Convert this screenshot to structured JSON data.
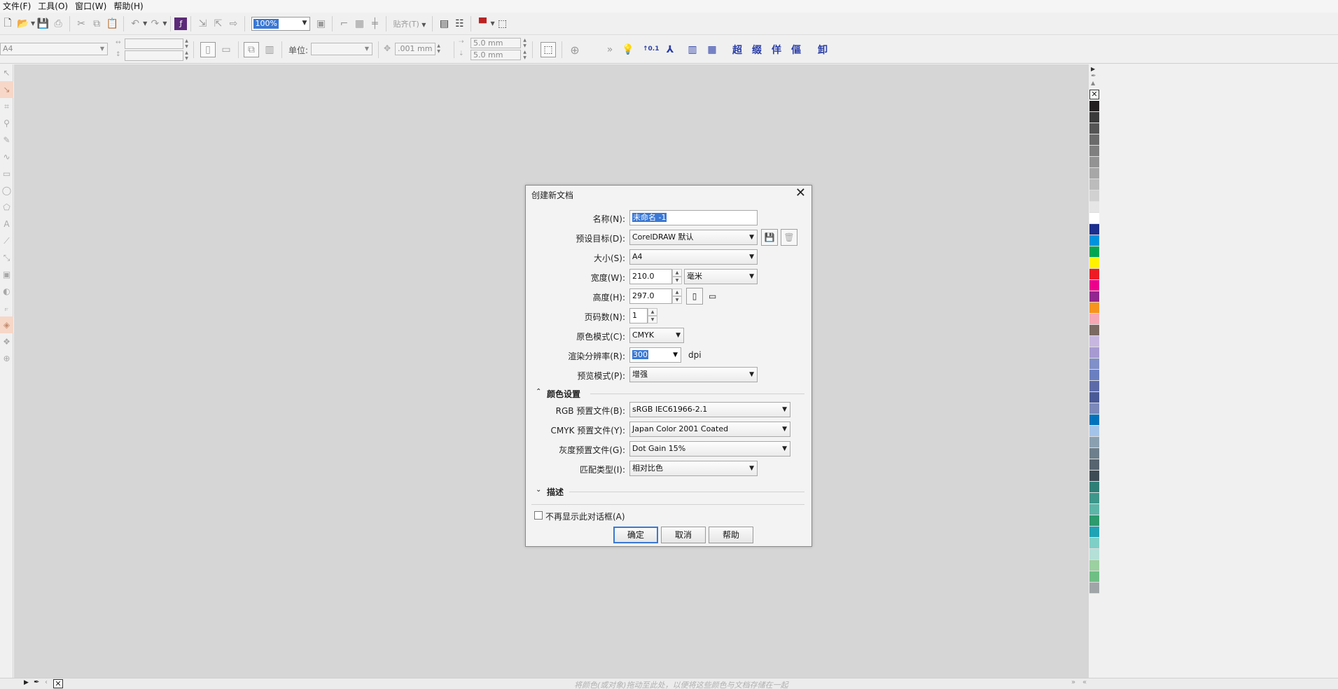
{
  "menu": [
    "文件(F)",
    "工具(O)",
    "窗口(W)",
    "帮助(H)"
  ],
  "toolbar": {
    "zoom": "100%",
    "snap_label": "贴齐(T)"
  },
  "propbar": {
    "page_size": "A4",
    "unit_label": "单位:",
    "nudge": ".001 mm",
    "dup_x": "5.0 mm",
    "dup_y": "5.0 mm",
    "tv_label": "↑0.1",
    "glyphs": [
      "超",
      "缀",
      "佯",
      "傴",
      "卸"
    ]
  },
  "status": {
    "hint": "将颜色(或对象)拖动至此处，以便将这些颜色与文档存储在一起"
  },
  "palette": [
    "#231f20",
    "#3b3b3b",
    "#555555",
    "#6b6b6b",
    "#7f7f7f",
    "#939393",
    "#a7a7a7",
    "#bcbcbc",
    "#d1d1d1",
    "#e6e6e6",
    "#ffffff",
    "#1d2f8f",
    "#0093dd",
    "#00a651",
    "#fff200",
    "#ed1c24",
    "#ec008c",
    "#92278f",
    "#f7941d",
    "#f6a7b4",
    "#7b6a63",
    "#c7b7e0",
    "#a79ad0",
    "#8090c8",
    "#6a7fc0",
    "#5c6aa8",
    "#4a5a98",
    "#7c88b8",
    "#0072bc",
    "#a3c4e8",
    "#8aa0b0",
    "#6d7f8c",
    "#56646f",
    "#3d4b55",
    "#2f7f76",
    "#3f968a",
    "#5db5a8",
    "#2e9a6d",
    "#1fa3b5",
    "#7fcfc6",
    "#b4e0d8",
    "#9bd0a0",
    "#6fbf84",
    "#a0a6a8"
  ],
  "dialog": {
    "title": "创建新文档",
    "labels": {
      "name": "名称(N):",
      "preset": "预设目标(D):",
      "size": "大小(S):",
      "width": "宽度(W):",
      "height": "高度(H):",
      "pages": "页码数(N):",
      "color_mode": "原色模式(C):",
      "resolution": "渲染分辨率(R):",
      "preview": "预览模式(P):",
      "rgb_profile": "RGB 预置文件(B):",
      "cmyk_profile": "CMYK 预置文件(Y):",
      "gray_profile": "灰度预置文件(G):",
      "match_type": "匹配类型(I):"
    },
    "values": {
      "name": "未命名 -1",
      "preset": "CorelDRAW 默认",
      "size": "A4",
      "width": "210.0 mm",
      "unit": "毫米",
      "height": "297.0 mm",
      "pages": "1",
      "color_mode": "CMYK",
      "resolution": "300",
      "resolution_unit": "dpi",
      "preview": "增强",
      "rgb_profile": "sRGB IEC61966-2.1",
      "cmyk_profile": "Japan Color 2001 Coated",
      "gray_profile": "Dot Gain 15%",
      "match_type": "相对比色"
    },
    "section_color": "颜色设置",
    "section_desc": "描述",
    "dont_show": "不再显示此对话框(A)",
    "ok": "确定",
    "cancel": "取消",
    "help": "帮助"
  }
}
